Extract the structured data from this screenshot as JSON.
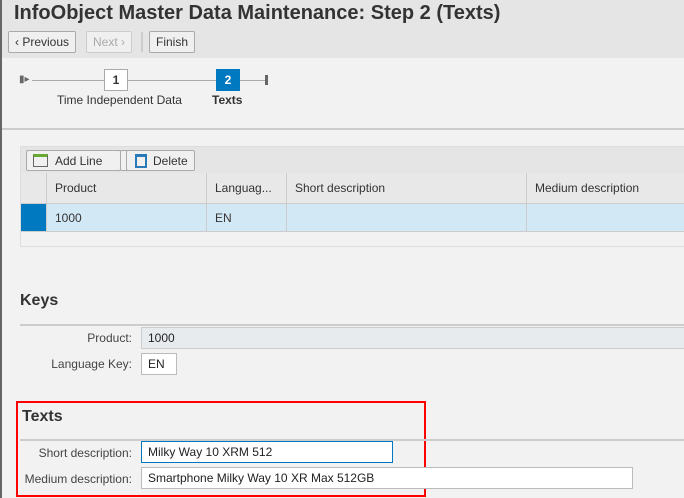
{
  "title": "InfoObject Master Data Maintenance: Step 2  (Texts)",
  "toolbar": {
    "previous": "Previous",
    "next": "Next",
    "finish": "Finish"
  },
  "roadmap": {
    "steps": [
      {
        "number": "1",
        "label": "Time Independent Data",
        "active": false
      },
      {
        "number": "2",
        "label": "Texts",
        "active": true
      }
    ]
  },
  "table": {
    "add_line": "Add Line",
    "delete": "Delete",
    "columns": [
      "Product",
      "Languag...",
      "Short description",
      "Medium description"
    ],
    "rows": [
      [
        "1000",
        "EN",
        "",
        ""
      ]
    ]
  },
  "keys": {
    "heading": "Keys",
    "product_label": "Product:",
    "product_value": "1000",
    "language_label": "Language Key:",
    "language_value": "EN"
  },
  "texts": {
    "heading": "Texts",
    "short_label": "Short description:",
    "short_value": "Milky Way 10 XRM 512",
    "medium_label": "Medium description:",
    "medium_value": "Smartphone Milky Way 10 XR Max 512GB"
  },
  "colors": {
    "accent": "#0079c1",
    "highlight": "#ff0000",
    "selected_row": "#d3e8f5"
  }
}
